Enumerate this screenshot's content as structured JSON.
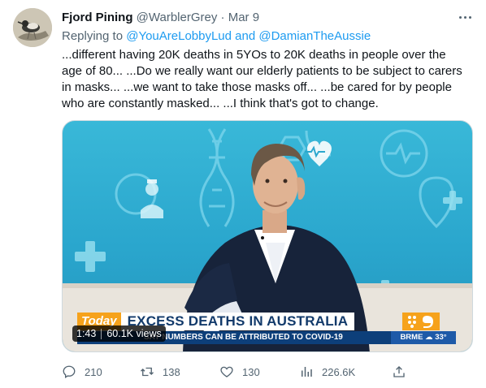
{
  "tweet": {
    "display_name": "Fjord Pining",
    "handle": "@WarblerGrey",
    "separator": "·",
    "date": "Mar 9",
    "replying_prefix": "Replying to",
    "mention_1": "@YouAreLobbyLud",
    "replying_and": "and",
    "mention_2": "@DamianTheAussie",
    "text": "...different having 20K deaths in 5YOs to 20K deaths in people over the age of 80... ...Do we really want our elderly patients to be subject to carers in masks... ...we want to take those masks off... ...be cared for by people who are constantly masked... ...I think that's got to change."
  },
  "media": {
    "chyron_logo": "Today",
    "headline": "EXCESS DEATHS IN AUSTRALIA",
    "subline": "SAY NUMBERS CAN BE ATTRIBUTED TO COVID-19",
    "weather": "BRME ☁ 33°",
    "video_time": "1:43",
    "video_views": "60.1K views"
  },
  "actions": {
    "replies": "210",
    "retweets": "138",
    "likes": "130",
    "views": "226.6K"
  },
  "icons": {
    "reply": "reply-icon",
    "retweet": "retweet-icon",
    "like": "heart-icon",
    "views": "analytics-icon",
    "share": "share-icon",
    "more": "more-icon"
  },
  "colors": {
    "link": "#1d9bf0",
    "secondary_text": "#536471",
    "headline_blue": "#123a6b",
    "today_orange": "#f6a21b"
  }
}
